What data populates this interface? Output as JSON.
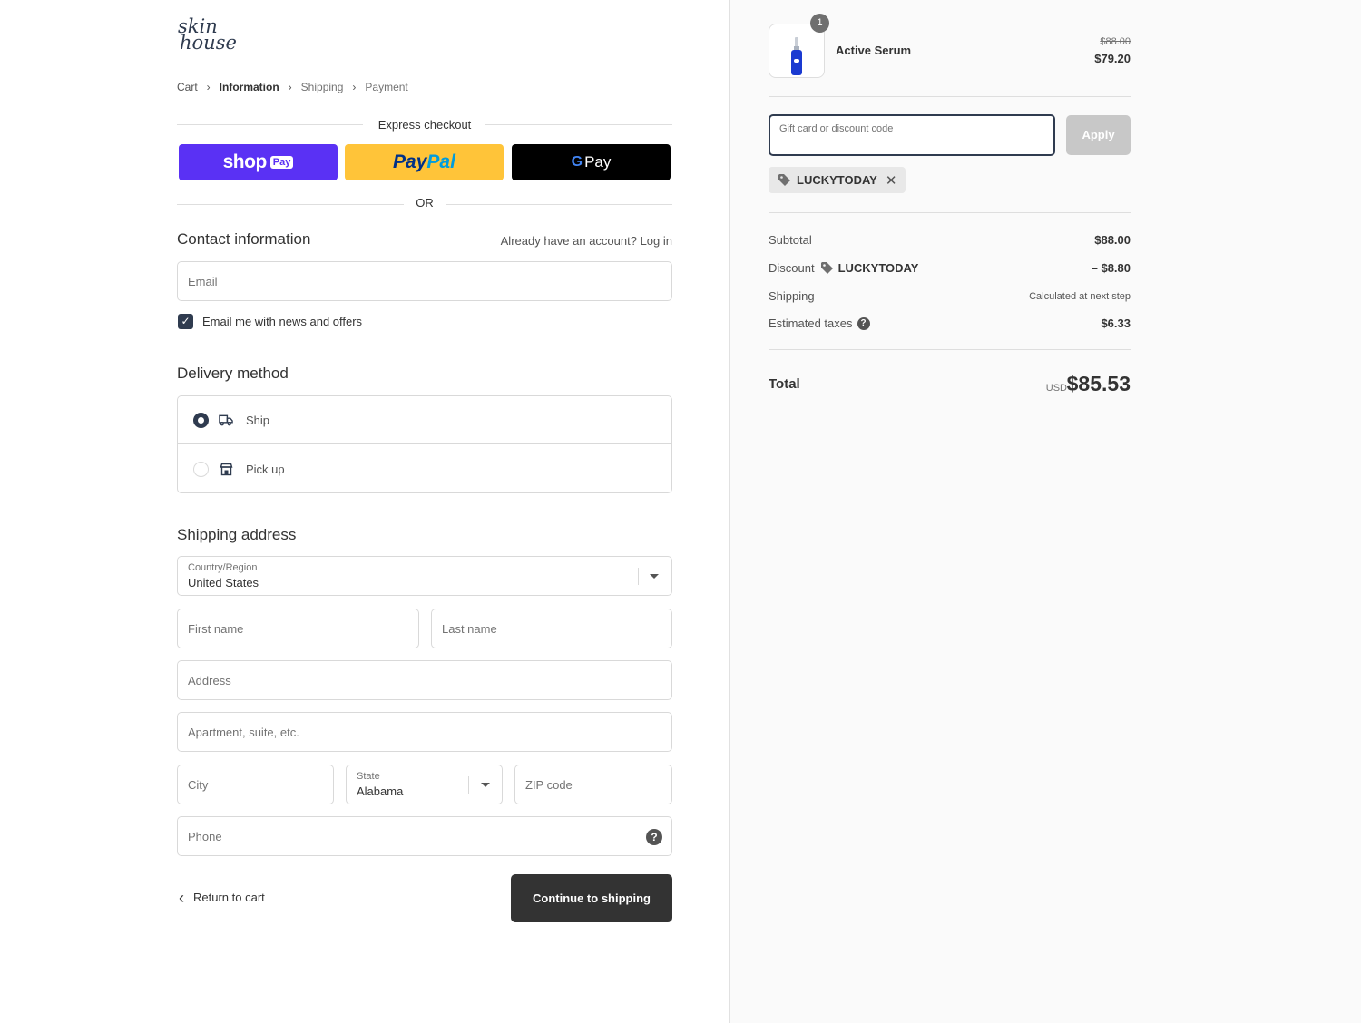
{
  "brand": {
    "logo_line1": "skin",
    "logo_line2": "house"
  },
  "breadcrumb": [
    "Cart",
    "Information",
    "Shipping",
    "Payment"
  ],
  "express": {
    "title": "Express checkout",
    "shop_pay_word": "shop",
    "shop_pay_badge": "Pay",
    "paypal_part1": "Pay",
    "paypal_part2": "Pal",
    "gpay_g": "G",
    "gpay_word": "Pay",
    "or_label": "OR"
  },
  "contact": {
    "title": "Contact information",
    "login_hint": "Already have an account? Log in",
    "email_placeholder": "Email",
    "newsletter_label": "Email me with news and offers",
    "newsletter_checked": true
  },
  "delivery": {
    "title": "Delivery method",
    "options": [
      {
        "label": "Ship",
        "selected": true
      },
      {
        "label": "Pick up",
        "selected": false
      }
    ]
  },
  "shipping_address": {
    "title": "Shipping address",
    "country_label": "Country/Region",
    "country_value": "United States",
    "first_name_placeholder": "First name",
    "last_name_placeholder": "Last name",
    "address_placeholder": "Address",
    "apartment_placeholder": "Apartment, suite, etc.",
    "city_placeholder": "City",
    "state_label": "State",
    "state_value": "Alabama",
    "zip_placeholder": "ZIP code",
    "phone_placeholder": "Phone",
    "help_icon_glyph": "?"
  },
  "actions": {
    "return_label": "Return to cart",
    "continue_label": "Continue to shipping"
  },
  "order": {
    "item": {
      "name": "Active Serum",
      "quantity": "1",
      "original_price": "$88.00",
      "price": "$79.20"
    },
    "discount_input_placeholder": "Gift card or discount code",
    "apply_label": "Apply",
    "applied_code": "LUCKYTODAY",
    "summary": {
      "subtotal_label": "Subtotal",
      "subtotal_value": "$88.00",
      "discount_label": "Discount",
      "discount_code": "LUCKYTODAY",
      "discount_value": "– $8.80",
      "shipping_label": "Shipping",
      "shipping_value": "Calculated at next step",
      "taxes_label": "Estimated taxes",
      "taxes_value": "$6.33",
      "total_label": "Total",
      "total_currency": "USD",
      "total_value": "$85.53"
    }
  },
  "colors": {
    "shop_pay": "#5a31f4",
    "paypal": "#ffc439",
    "gpay": "#000000",
    "accent": "#2f3b4f",
    "continue_button": "#333333",
    "apply_disabled": "#c8c8c8"
  }
}
